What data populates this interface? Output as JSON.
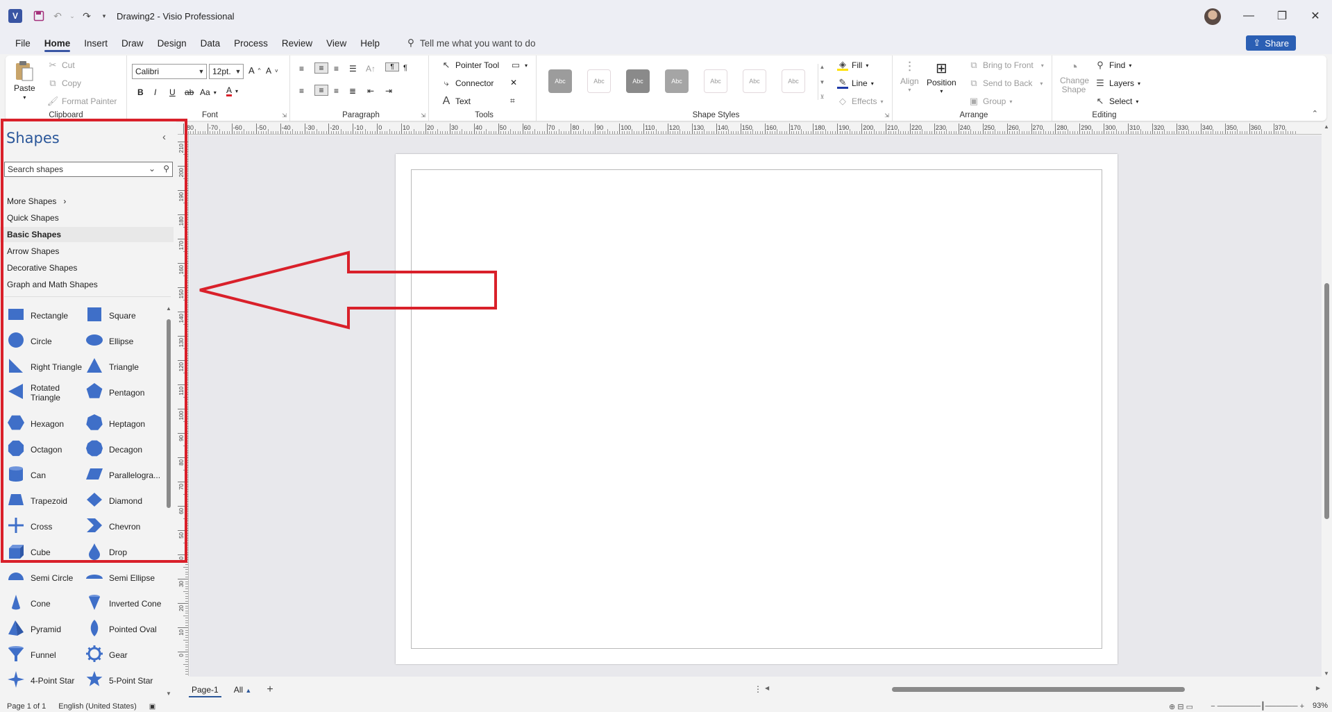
{
  "window": {
    "app_icon": "visio-logo-icon",
    "title": "Drawing2  -  Visio Professional",
    "controls": [
      "minimize-icon",
      "restore-icon",
      "close-icon"
    ]
  },
  "menu": {
    "tabs": [
      "File",
      "Home",
      "Insert",
      "Draw",
      "Design",
      "Data",
      "Process",
      "Review",
      "View",
      "Help"
    ],
    "active": "Home",
    "tell_me": "Tell me what you want to do",
    "share": "Share"
  },
  "ribbon": {
    "clipboard": {
      "label": "Clipboard",
      "paste": "Paste",
      "cut": "Cut",
      "copy": "Copy",
      "format_painter": "Format Painter"
    },
    "font": {
      "label": "Font",
      "family": "Calibri",
      "size": "12pt.",
      "bold": "B",
      "italic": "I",
      "underline": "U",
      "strike": "ab",
      "case": "Aa",
      "color_letter": "A",
      "font_color": "#d9202a"
    },
    "paragraph": {
      "label": "Paragraph"
    },
    "tools": {
      "label": "Tools",
      "pointer": "Pointer Tool",
      "connector": "Connector",
      "text": "Text"
    },
    "shape_styles": {
      "label": "Shape Styles",
      "swatch_text": "Abc",
      "swatches": [
        "#9c9c9c",
        "light",
        "#8a8a8a",
        "#a5a5a5",
        "light",
        "light",
        "light"
      ]
    },
    "fill_line": {
      "fill": "Fill",
      "line": "Line",
      "effects": "Effects",
      "fill_color": "#ffe100",
      "line_color": "#1f3aa8"
    },
    "arrange": {
      "label": "Arrange",
      "align": "Align",
      "position": "Position",
      "bring_to_front": "Bring to Front",
      "send_to_back": "Send to Back",
      "group": "Group"
    },
    "editing": {
      "label": "Editing",
      "change_shape": "Change Shape",
      "find": "Find",
      "layers": "Layers",
      "select": "Select"
    }
  },
  "shapes_panel": {
    "title": "Shapes",
    "search_placeholder": "Search shapes",
    "stencils": [
      "More Shapes",
      "Quick Shapes",
      "Basic Shapes",
      "Arrow Shapes",
      "Decorative Shapes",
      "Graph and Math Shapes"
    ],
    "active_stencil": "Basic Shapes",
    "shapes": [
      [
        "Rectangle",
        "rectangle-icon"
      ],
      [
        "Square",
        "square-icon"
      ],
      [
        "Circle",
        "circle-icon"
      ],
      [
        "Ellipse",
        "ellipse-icon"
      ],
      [
        "Right Triangle",
        "right-triangle-icon"
      ],
      [
        "Triangle",
        "triangle-icon"
      ],
      [
        "Rotated Triangle",
        "rotated-triangle-icon"
      ],
      [
        "Pentagon",
        "pentagon-icon"
      ],
      [
        "Hexagon",
        "hexagon-icon"
      ],
      [
        "Heptagon",
        "heptagon-icon"
      ],
      [
        "Octagon",
        "octagon-icon"
      ],
      [
        "Decagon",
        "decagon-icon"
      ],
      [
        "Can",
        "can-icon"
      ],
      [
        "Parallelogra...",
        "parallelogram-icon"
      ],
      [
        "Trapezoid",
        "trapezoid-icon"
      ],
      [
        "Diamond",
        "diamond-icon"
      ],
      [
        "Cross",
        "cross-icon"
      ],
      [
        "Chevron",
        "chevron-icon"
      ],
      [
        "Cube",
        "cube-icon"
      ],
      [
        "Drop",
        "drop-icon"
      ],
      [
        "Semi Circle",
        "semi-circle-icon"
      ],
      [
        "Semi Ellipse",
        "semi-ellipse-icon"
      ],
      [
        "Cone",
        "cone-icon"
      ],
      [
        "Inverted Cone",
        "inverted-cone-icon"
      ],
      [
        "Pyramid",
        "pyramid-icon"
      ],
      [
        "Pointed Oval",
        "pointed-oval-icon"
      ],
      [
        "Funnel",
        "funnel-icon"
      ],
      [
        "Gear",
        "gear-icon"
      ],
      [
        "4-Point Star",
        "four-point-star-icon"
      ],
      [
        "5-Point Star",
        "five-point-star-icon"
      ]
    ],
    "shape_color": "#3f6fc8"
  },
  "rulers": {
    "top": [
      "-80",
      "-70",
      "-60",
      "-50",
      "-40",
      "-30",
      "-20",
      "-10",
      "0",
      "10",
      "20",
      "30",
      "40",
      "50",
      "60",
      "70",
      "80",
      "90",
      "100",
      "110",
      "120",
      "130",
      "140",
      "150",
      "160",
      "170",
      "180",
      "190",
      "200",
      "210",
      "220",
      "230",
      "240",
      "250",
      "260",
      "270",
      "280",
      "290",
      "300",
      "310",
      "320",
      "330",
      "340",
      "350",
      "360",
      "370"
    ],
    "left": [
      "210",
      "200",
      "190",
      "180",
      "170",
      "160",
      "150",
      "140",
      "130",
      "120",
      "110",
      "100",
      "90",
      "80",
      "70",
      "60",
      "50",
      "40",
      "30",
      "20",
      "10",
      "0"
    ]
  },
  "pages": {
    "current": "Page-1",
    "all": "All"
  },
  "status": {
    "page": "Page 1 of 1",
    "language": "English (United States)",
    "zoom": "93%"
  },
  "annotation": {
    "color": "#d9202a"
  }
}
